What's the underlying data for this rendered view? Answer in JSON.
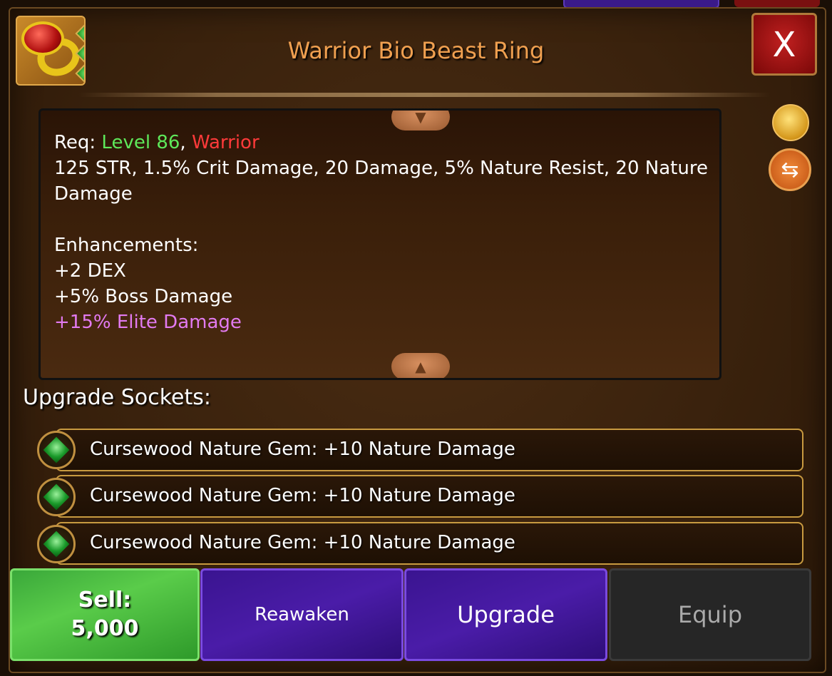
{
  "item": {
    "name": "Warrior Bio Beast Ring",
    "rarity_dots": [
      "#ffffff",
      "#ffffff",
      "#e27af0"
    ]
  },
  "close_label": "X",
  "description": {
    "req_prefix": "Req: ",
    "req_level": "Level 86",
    "req_sep": ", ",
    "req_class": "Warrior",
    "stats": "125 STR, 1.5% Crit Damage, 20 Damage, 5% Nature Resist, 20 Nature Damage",
    "enhancements_heading": "Enhancements:",
    "enhancements": [
      "+2 DEX",
      "+5% Boss Damage",
      "+15% Elite Damage"
    ]
  },
  "sockets": {
    "title": "Upgrade Sockets:",
    "items": [
      {
        "label": "Cursewood Nature Gem: +10 Nature Damage"
      },
      {
        "label": "Cursewood Nature Gem: +10 Nature Damage"
      },
      {
        "label": "Cursewood Nature Gem: +10 Nature Damage"
      }
    ]
  },
  "buttons": {
    "sell_label": "Sell:",
    "sell_price": "5,000",
    "reawaken": "Reawaken",
    "upgrade": "Upgrade",
    "equip": "Equip"
  },
  "colors": {
    "title": "#f0a050",
    "level": "#5ee85a",
    "class": "#ff3a3a",
    "elite_enhancement": "#e27af0"
  },
  "icons": {
    "item": "ring-icon",
    "gold": "gold-bag-icon",
    "swap": "swap-icon"
  }
}
